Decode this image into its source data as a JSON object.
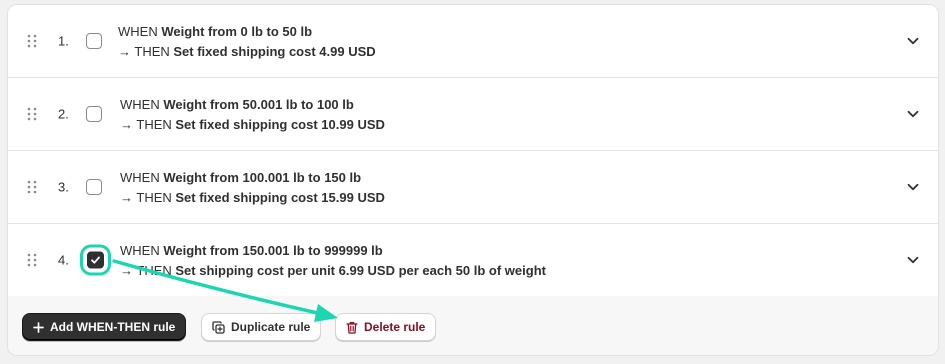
{
  "accent_color": "#1bd6b0",
  "rules": [
    {
      "number": "1.",
      "checked": false,
      "when_prefix": "WHEN",
      "when_condition": "Weight from 0 lb to 50 lb",
      "then_prefix": "→ THEN",
      "then_action": "Set fixed shipping cost 4.99 USD"
    },
    {
      "number": "2.",
      "checked": false,
      "when_prefix": "WHEN",
      "when_condition": "Weight from 50.001 lb to 100 lb",
      "then_prefix": "→ THEN",
      "then_action": "Set fixed shipping cost 10.99 USD"
    },
    {
      "number": "3.",
      "checked": false,
      "when_prefix": "WHEN",
      "when_condition": "Weight from 100.001 lb to 150 lb",
      "then_prefix": "→ THEN",
      "then_action": "Set fixed shipping cost 15.99 USD"
    },
    {
      "number": "4.",
      "checked": true,
      "when_prefix": "WHEN",
      "when_condition": "Weight from 150.001 lb to 999999 lb",
      "then_prefix": "→ THEN",
      "then_action": "Set shipping cost per unit 6.99 USD per each 50 lb of weight"
    }
  ],
  "footer": {
    "add_label": "Add WHEN-THEN rule",
    "duplicate_label": "Duplicate rule",
    "delete_label": "Delete rule"
  },
  "icons": {
    "drag": "drag-handle-icon",
    "expand": "chevron-down-icon",
    "add": "plus-icon",
    "duplicate": "duplicate-icon",
    "delete": "trash-icon"
  }
}
